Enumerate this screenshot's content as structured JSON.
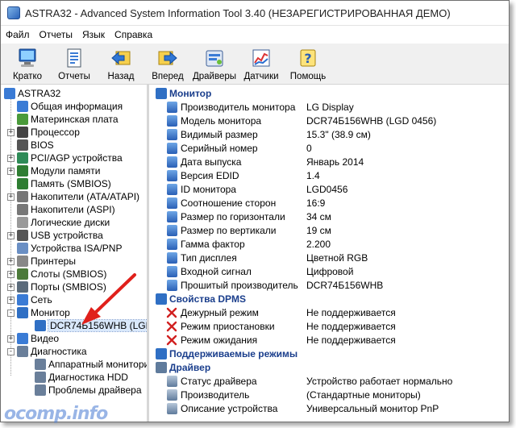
{
  "window": {
    "title": "ASTRA32 - Advanced System Information Tool 3.40 (НЕЗАРЕГИСТРИРОВАННАЯ ДЕМО)"
  },
  "menu": [
    "Файл",
    "Отчеты",
    "Язык",
    "Справка"
  ],
  "toolbar": [
    {
      "label": "Кратко",
      "icon": "computer-icon"
    },
    {
      "label": "Отчеты",
      "icon": "report-icon"
    },
    {
      "label": "Назад",
      "icon": "back-icon"
    },
    {
      "label": "Вперед",
      "icon": "forward-icon"
    },
    {
      "label": "Драйверы",
      "icon": "drivers-icon"
    },
    {
      "label": "Датчики",
      "icon": "sensors-icon"
    },
    {
      "label": "Помощь",
      "icon": "help-icon"
    }
  ],
  "tree": [
    {
      "label": "ASTRA32",
      "icon": "computer-icon"
    },
    {
      "label": "Общая информация",
      "icon": "computer-icon"
    },
    {
      "label": "Материнская плата",
      "icon": "motherboard-icon"
    },
    {
      "label": "Процессор",
      "icon": "cpu-icon"
    },
    {
      "label": "BIOS",
      "icon": "chip-icon"
    },
    {
      "label": "PCI/AGP устройства",
      "icon": "pci-icon"
    },
    {
      "label": "Модули памяти",
      "icon": "memory-icon"
    },
    {
      "label": "Память (SMBIOS)",
      "icon": "memory-icon"
    },
    {
      "label": "Накопители (ATA/ATAPI)",
      "icon": "drive-icon"
    },
    {
      "label": "Накопители (ASPI)",
      "icon": "drive-icon"
    },
    {
      "label": "Логические диски",
      "icon": "disk-icon"
    },
    {
      "label": "USB устройства",
      "icon": "usb-icon"
    },
    {
      "label": "Устройства ISA/PNP",
      "icon": "isa-icon"
    },
    {
      "label": "Принтеры",
      "icon": "printer-icon"
    },
    {
      "label": "Слоты (SMBIOS)",
      "icon": "slot-icon"
    },
    {
      "label": "Порты (SMBIOS)",
      "icon": "port-icon"
    },
    {
      "label": "Сеть",
      "icon": "network-icon"
    },
    {
      "label": "Монитор",
      "icon": "monitor-icon"
    },
    {
      "label": "DCR74Б156WHB (LGD",
      "icon": "monitor-icon"
    },
    {
      "label": "Видео",
      "icon": "video-icon"
    },
    {
      "label": "Диагностика",
      "icon": "diagnostics-icon"
    },
    {
      "label": "Аппаратный монитори",
      "icon": "diagnostics-icon"
    },
    {
      "label": "Диагностика HDD",
      "icon": "diagnostics-icon"
    },
    {
      "label": "Проблемы драйвера",
      "icon": "diagnostics-icon"
    }
  ],
  "sections": {
    "monitor": "Монитор",
    "dpms": "Свойства DPMS",
    "modes": "Поддерживаемые режимы",
    "driver": "Драйвер"
  },
  "monitor_props": [
    {
      "name": "Производитель монитора",
      "value": "LG Display"
    },
    {
      "name": "Модель монитора",
      "value": "DCR74Б156WHB (LGD 0456)"
    },
    {
      "name": "Видимый размер",
      "value": "15.3\" (38.9 см)"
    },
    {
      "name": "Серийный номер",
      "value": "0"
    },
    {
      "name": "Дата выпуска",
      "value": "Январь 2014"
    },
    {
      "name": "Версия EDID",
      "value": "1.4"
    },
    {
      "name": "ID монитора",
      "value": "LGD0456"
    },
    {
      "name": "Соотношение сторон",
      "value": "16:9"
    },
    {
      "name": "Размер по горизонтали",
      "value": "34 см"
    },
    {
      "name": "Размер по вертикали",
      "value": "19 см"
    },
    {
      "name": "Гамма фактор",
      "value": "2.200"
    },
    {
      "name": "Тип дисплея",
      "value": "Цветной RGB"
    },
    {
      "name": "Входной сигнал",
      "value": "Цифровой"
    },
    {
      "name": "Прошитый производитель",
      "value": "DCR74Б156WHB"
    }
  ],
  "dpms_props": [
    {
      "name": "Дежурный режим",
      "value": "Не поддерживается"
    },
    {
      "name": "Режим приостановки",
      "value": "Не поддерживается"
    },
    {
      "name": "Режим ожидания",
      "value": "Не поддерживается"
    }
  ],
  "driver_props": [
    {
      "name": "Статус драйвера",
      "value": "Устройство работает нормально"
    },
    {
      "name": "Производитель",
      "value": "(Стандартные мониторы)"
    },
    {
      "name": "Описание устройства",
      "value": "Универсальный монитор PnP"
    }
  ],
  "watermark": "ocomp.info",
  "colors": {
    "section_text": "#1a3e8c",
    "tree_selection": "#d9e8fb",
    "arrow": "#e0201b"
  }
}
